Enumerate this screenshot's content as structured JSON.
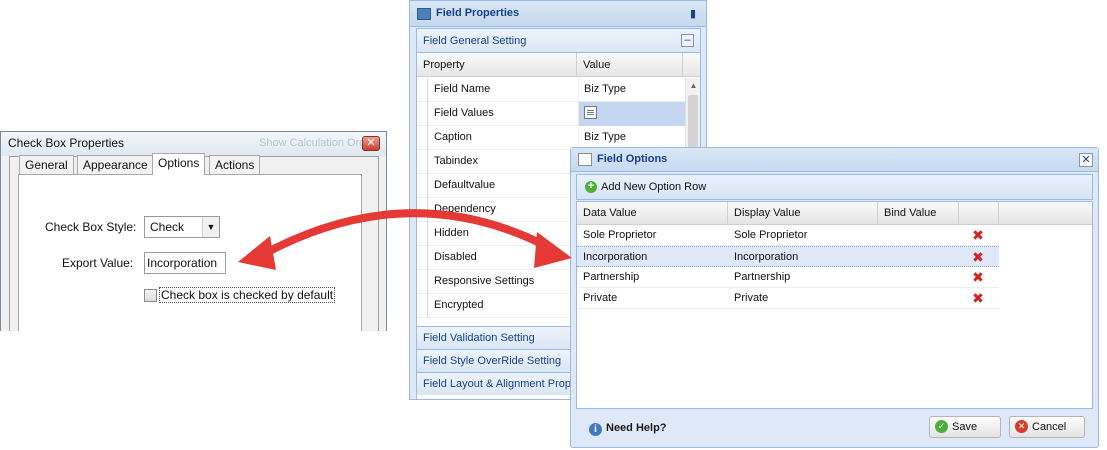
{
  "check_box_properties": {
    "title": "Check Box Properties",
    "ghost_text": "Show Calculation Ord",
    "tabs": [
      "General",
      "Appearance",
      "Options",
      "Actions"
    ],
    "active_tab": "Options",
    "style_label": "Check Box Style:",
    "style_value": "Check",
    "export_label": "Export Value:",
    "export_value": "Incorporation",
    "default_checkbox_label": "Check box is checked by default"
  },
  "field_properties": {
    "title": "Field Properties",
    "sections": {
      "general": "Field General Setting",
      "validation": "Field Validation Setting",
      "style_override": "Field Style OverRide Setting",
      "layout": "Field Layout & Alignment Prop"
    },
    "grid_headers": {
      "property": "Property",
      "value": "Value"
    },
    "rows": [
      {
        "name": "Field Name",
        "value": "Biz Type"
      },
      {
        "name": "Field Values",
        "value": ""
      },
      {
        "name": "Caption",
        "value": "Biz Type"
      },
      {
        "name": "Tabindex",
        "value": ""
      },
      {
        "name": "Defaultvalue",
        "value": ""
      },
      {
        "name": "Dependency",
        "value": ""
      },
      {
        "name": "Hidden",
        "value": ""
      },
      {
        "name": "Disabled",
        "value": ""
      },
      {
        "name": "Responsive Settings",
        "value": ""
      },
      {
        "name": "Encrypted",
        "value": ""
      }
    ]
  },
  "field_options": {
    "title": "Field Options",
    "add_row_label": "Add New Option Row",
    "headers": {
      "data_value": "Data Value",
      "display_value": "Display Value",
      "bind_value": "Bind Value"
    },
    "rows": [
      {
        "data": "Sole Proprietor",
        "display": "Sole Proprietor",
        "bind": ""
      },
      {
        "data": "Incorporation",
        "display": "Incorporation",
        "bind": ""
      },
      {
        "data": "Partnership",
        "display": "Partnership",
        "bind": ""
      },
      {
        "data": "Private",
        "display": "Private",
        "bind": ""
      }
    ],
    "selected_row": 1,
    "help_label": "Need Help?",
    "save_label": "Save",
    "cancel_label": "Cancel"
  },
  "colors": {
    "arrow": "#e53935",
    "ext_header_text": "#15428b",
    "ext_border": "#99bbe8",
    "delete_icon": "#d32222"
  }
}
